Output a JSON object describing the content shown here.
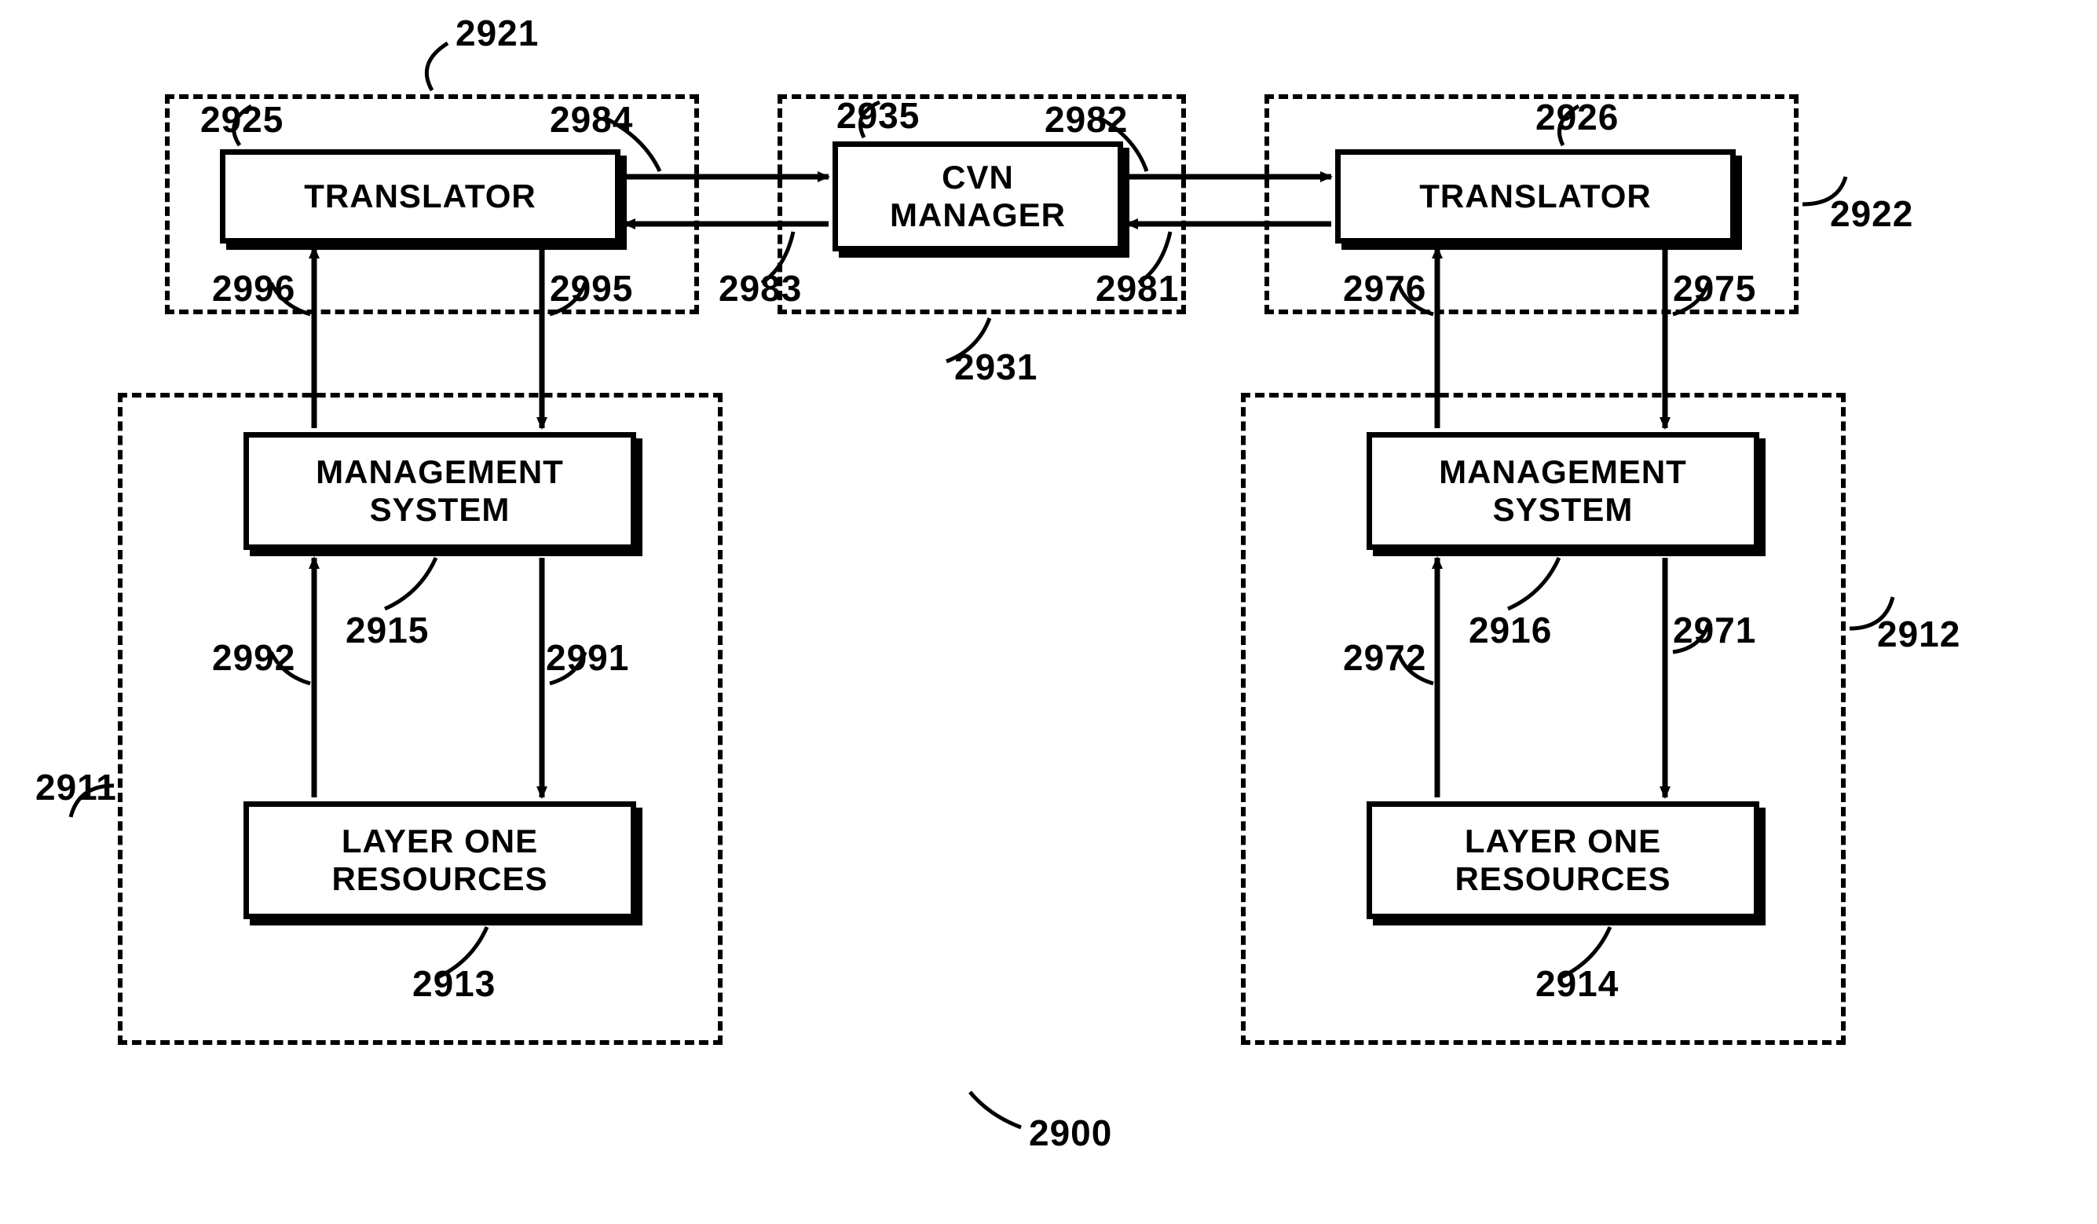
{
  "boxes": {
    "translator_left": "TRANSLATOR",
    "translator_right": "TRANSLATOR",
    "cvn_manager_l1": "CVN",
    "cvn_manager_l2": "MANAGER",
    "mgmt_left_l1": "MANAGEMENT",
    "mgmt_left_l2": "SYSTEM",
    "mgmt_right_l1": "MANAGEMENT",
    "mgmt_right_l2": "SYSTEM",
    "layer_left_l1": "LAYER ONE",
    "layer_left_l2": "RESOURCES",
    "layer_right_l1": "LAYER ONE",
    "layer_right_l2": "RESOURCES"
  },
  "refs": {
    "r2921": "2921",
    "r2925": "2925",
    "r2984": "2984",
    "r2935": "2935",
    "r2982": "2982",
    "r2926": "2926",
    "r2922": "2922",
    "r2996": "2996",
    "r2995": "2995",
    "r2983": "2983",
    "r2981": "2981",
    "r2976": "2976",
    "r2975": "2975",
    "r2931": "2931",
    "r2911": "2911",
    "r2915": "2915",
    "r2992": "2992",
    "r2991": "2991",
    "r2913": "2913",
    "r2916": "2916",
    "r2971": "2971",
    "r2972": "2972",
    "r2912": "2912",
    "r2914": "2914",
    "r2900": "2900"
  }
}
